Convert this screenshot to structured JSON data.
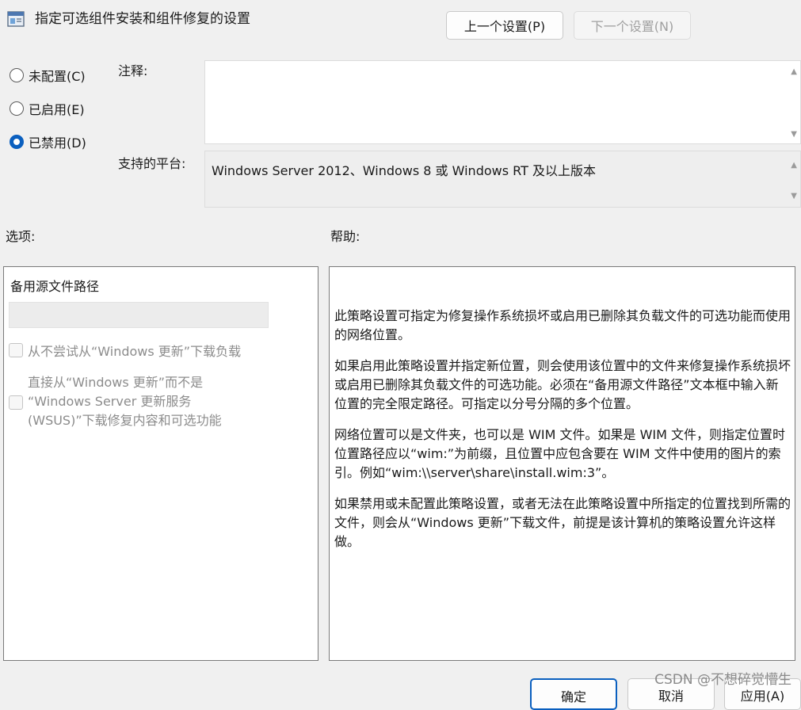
{
  "window": {
    "title": "指定可选组件安装和组件修复的设置"
  },
  "nav": {
    "prev": "上一个设置(P)",
    "next": "下一个设置(N)"
  },
  "state": {
    "options": [
      "未配置(C)",
      "已启用(E)",
      "已禁用(D)"
    ],
    "selected": "已禁用(D)"
  },
  "comment": {
    "label": "注释:",
    "value": ""
  },
  "platform": {
    "label": "支持的平台:",
    "value": "Windows Server 2012、Windows 8 或 Windows RT 及以上版本"
  },
  "options_section": {
    "label": "选项:",
    "path_label": "备用源文件路径",
    "path_value": "",
    "checkbox1": "从不尝试从“Windows 更新”下载负载",
    "checkbox2_lines": [
      "直接从“Windows 更新”而不是",
      "“Windows Server 更新服务",
      "(WSUS)”下载修复内容和可选功能"
    ]
  },
  "help_section": {
    "label": "帮助:",
    "paragraphs": [
      "此策略设置可指定为修复操作系统损坏或启用已删除其负载文件的可选功能而使用的网络位置。",
      "如果启用此策略设置并指定新位置，则会使用该位置中的文件来修复操作系统损坏或启用已删除其负载文件的可选功能。必须在“备用源文件路径”文本框中输入新位置的完全限定路径。可指定以分号分隔的多个位置。",
      "网络位置可以是文件夹，也可以是 WIM 文件。如果是 WIM 文件，则指定位置时位置路径应以“wim:”为前缀，且位置中应包含要在 WIM 文件中使用的图片的索引。例如“wim:\\\\server\\share\\install.wim:3”。",
      "如果禁用或未配置此策略设置，或者无法在此策略设置中所指定的位置找到所需的文件，则会从“Windows 更新”下载文件，前提是该计算机的策略设置允许这样做。"
    ]
  },
  "footer": {
    "ok": "确定",
    "cancel": "取消",
    "apply": "应用(A)"
  },
  "watermark": "CSDN @不想碎觉懵生",
  "colors": {
    "accent": "#0a5fbf",
    "panel_border": "#7a7a7a"
  }
}
